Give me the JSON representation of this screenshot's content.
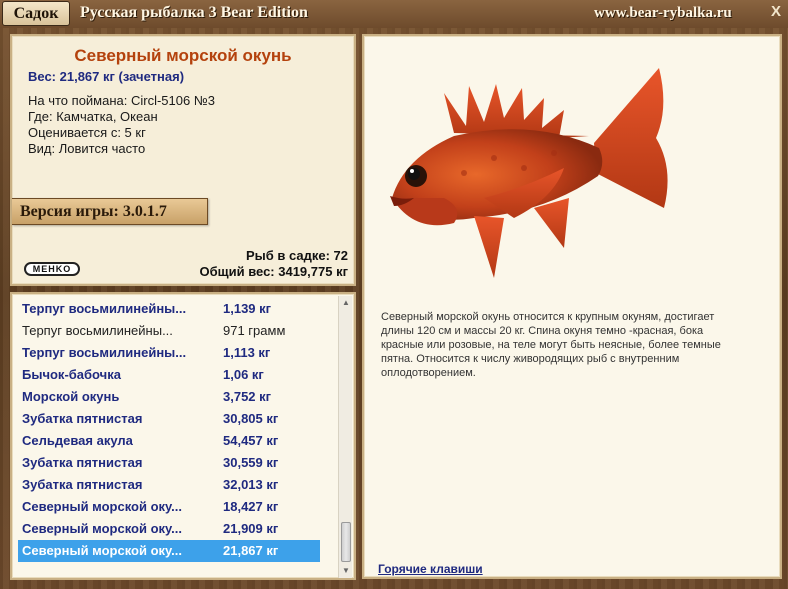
{
  "titlebar": {
    "sadok_label": "Садок",
    "app_title": "Русская рыбалка 3 Bear Edition",
    "site_url": "www.bear-rybalka.ru",
    "close_label": "X"
  },
  "fish": {
    "name": "Северный морской окунь",
    "weight_line": "Вес: 21,867 кг (зачетная)",
    "caught_with": "На что поймана: Circl-5106 №3",
    "location": "Где: Камчатка, Океан",
    "valued_from": "Оценивается с: 5 кг",
    "kind": "Вид: Ловится часто",
    "description": "Северный морской окунь относится к крупным окуням, достигает длины 120 см и массы 20 кг. Спина окуня темно -красная, бока красные или розовые, на теле могут быть неясные, более темные пятна. Относится к числу живородящих рыб с внутренним оплодотворением."
  },
  "version_label": "Версия игры: 3.0.1.7",
  "logo_text": "MEHKO",
  "stats": {
    "fish_count": "Рыб в садке: 72",
    "total_weight": "Общий вес: 3419,775 кг"
  },
  "hotkeys_label": "Горячие клавиши",
  "catch_list": [
    {
      "name": "Терпуг восьмилинейны...",
      "weight": "1,139 кг",
      "style": "bold"
    },
    {
      "name": "Терпуг восьмилинейны...",
      "weight": "971 грамм",
      "style": "plain"
    },
    {
      "name": "Терпуг восьмилинейны...",
      "weight": "1,113 кг",
      "style": "bold"
    },
    {
      "name": "Бычок-бабочка",
      "weight": "1,06 кг",
      "style": "bold"
    },
    {
      "name": "Морской окунь",
      "weight": "3,752 кг",
      "style": "bold"
    },
    {
      "name": "Зубатка пятнистая",
      "weight": "30,805 кг",
      "style": "bold"
    },
    {
      "name": "Сельдевая акула",
      "weight": "54,457 кг",
      "style": "bold"
    },
    {
      "name": "Зубатка пятнистая",
      "weight": "30,559 кг",
      "style": "bold"
    },
    {
      "name": "Зубатка пятнистая",
      "weight": "32,013 кг",
      "style": "bold"
    },
    {
      "name": "Северный морской оку...",
      "weight": "18,427 кг",
      "style": "bold"
    },
    {
      "name": "Северный морской оку...",
      "weight": "21,909 кг",
      "style": "bold"
    },
    {
      "name": "Северный морской оку...",
      "weight": "21,867 кг",
      "style": "selected"
    }
  ],
  "colors": {
    "accent_title": "#b4420d",
    "list_text": "#1f2a80",
    "selection": "#3da1ea"
  }
}
